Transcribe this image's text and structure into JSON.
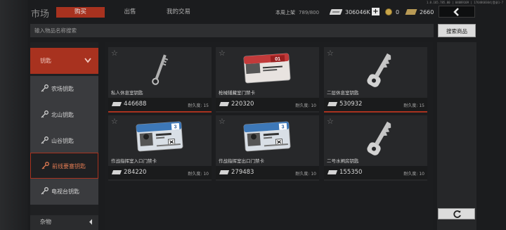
{
  "debug_text": "1.0.165.785.00 | 04089109 | 1764868304|登录1-7",
  "header": {
    "title": "市场",
    "tabs": [
      {
        "label": "购买",
        "active": true
      },
      {
        "label": "出售",
        "active": false
      },
      {
        "label": "我的交易",
        "active": false
      }
    ],
    "weekly_shelf_label": "本周上架",
    "weekly_shelf_value": "789/800",
    "cash": "306046K",
    "coins": "0",
    "gold": "2660",
    "back_icon": "chevron-left-icon"
  },
  "search": {
    "placeholder": "输入物品名称搜索",
    "button_label": "搜索商品"
  },
  "sidebar": {
    "category": "钥匙",
    "items": [
      {
        "label": "农场钥匙",
        "active": false
      },
      {
        "label": "北山钥匙",
        "active": false
      },
      {
        "label": "山谷钥匙",
        "active": false
      },
      {
        "label": "前线要塞钥匙",
        "active": true
      },
      {
        "label": "电视台钥匙",
        "active": false
      }
    ],
    "misc_label": "杂物"
  },
  "items": [
    {
      "name": "私人休息室钥匙",
      "price": "446688",
      "durability": "耐久度: 15",
      "art": "key-thin",
      "bid": true
    },
    {
      "name": "枪械辅藏室门禁卡",
      "price": "220320",
      "durability": "耐久度: 10",
      "art": "card-red",
      "card_number": "01",
      "bid": false
    },
    {
      "name": "二层休息室钥匙",
      "price": "530932",
      "durability": "耐久度: 15",
      "art": "key",
      "bid": true
    },
    {
      "name": "作战指挥室入口门禁卡",
      "price": "284220",
      "durability": "耐久度: 10",
      "art": "card-blue",
      "card_number": "3",
      "bid": false
    },
    {
      "name": "作战指挥室出口门禁卡",
      "price": "279483",
      "durability": "耐久度: 10",
      "art": "card-blue",
      "card_number": "3",
      "bid": false
    },
    {
      "name": "二号水闸房钥匙",
      "price": "155350",
      "durability": "耐久度: 10",
      "art": "key",
      "bid": false
    }
  ],
  "colors": {
    "accent": "#a8321f",
    "background": "#1b1c1e"
  },
  "refresh_icon": "refresh-icon"
}
